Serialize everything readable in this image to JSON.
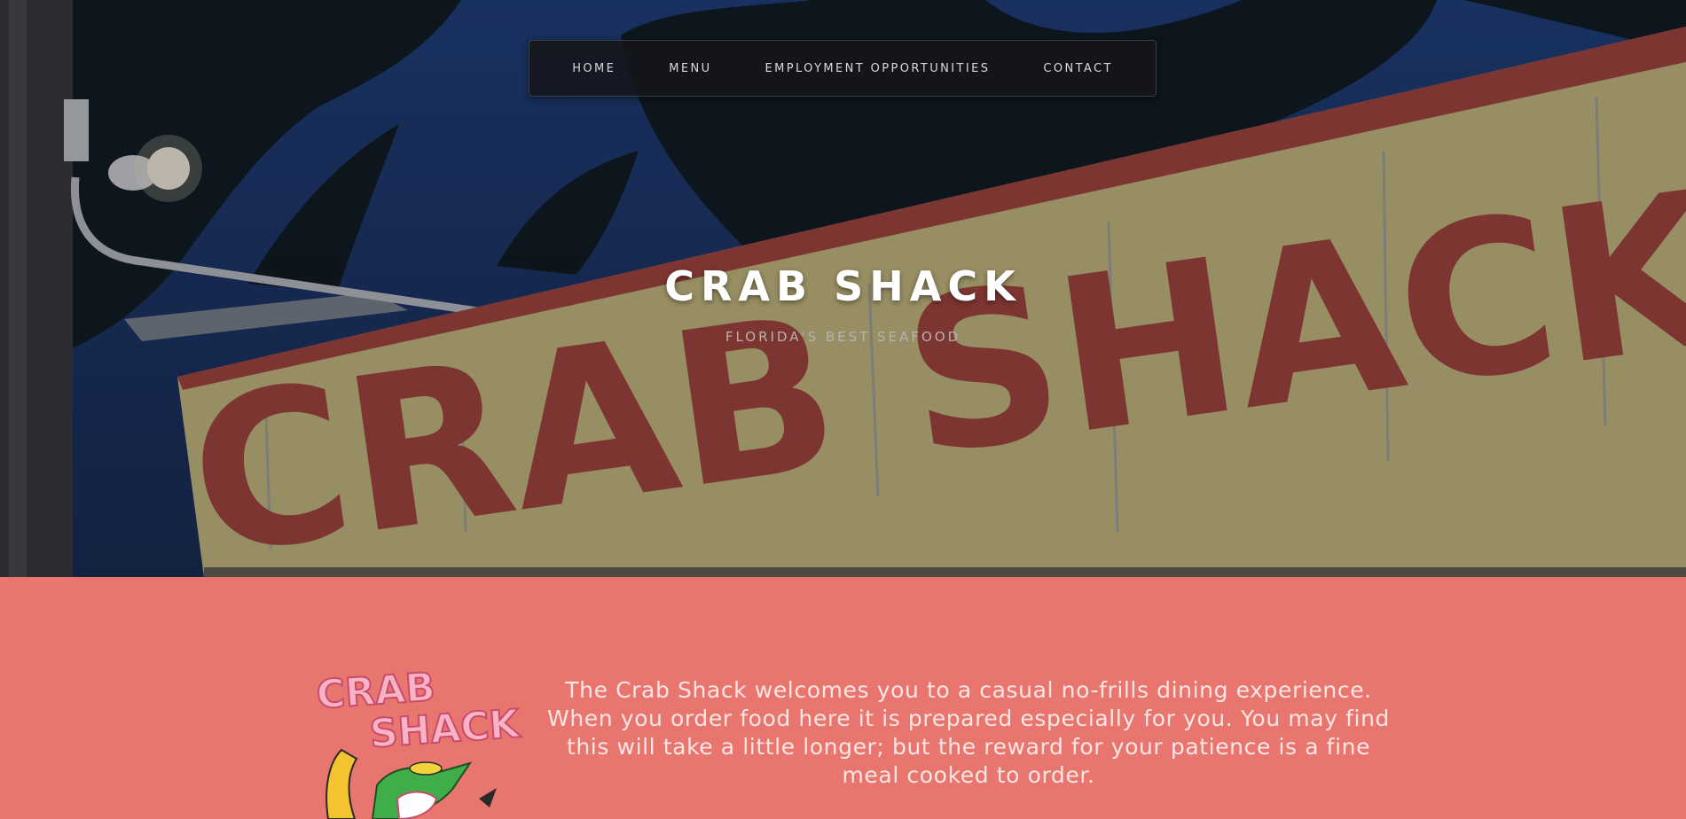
{
  "nav": {
    "items": [
      {
        "label": "HOME"
      },
      {
        "label": "MENU"
      },
      {
        "label": "EMPLOYMENT OPPORTUNITIES"
      },
      {
        "label": "CONTACT"
      }
    ]
  },
  "hero": {
    "title": "CRAB SHACK",
    "tagline": "FLORIDA'S BEST SEAFOOD",
    "sign_text": "CRAB SHACK"
  },
  "logo": {
    "text_line1": "CRAB",
    "text_line2": "SHACK"
  },
  "intro": {
    "text": "The Crab Shack welcomes you to a casual no-frills dining experience. When you order food here it is prepared especially for you. You may find this will take a little longer; but the reward for your patience is a fine meal cooked to order."
  },
  "colors": {
    "content_bg": "#e8756e",
    "nav_bg": "#14161a",
    "sign_bg": "#cfc07e",
    "sign_letters": "#a8453a"
  }
}
